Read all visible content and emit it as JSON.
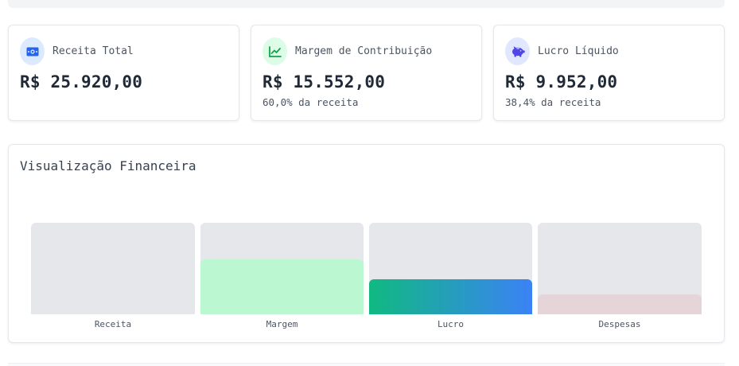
{
  "cards": [
    {
      "icon": "money-bill-icon",
      "icon_color": "#2563eb",
      "icon_bg": "#dbeafe",
      "label": "Receita Total",
      "value": "R$ 25.920,00",
      "sub": ""
    },
    {
      "icon": "chart-line-icon",
      "icon_color": "#16a34a",
      "icon_bg": "#dcfce7",
      "label": "Margem de Contribuição",
      "value": "R$ 15.552,00",
      "sub": "60,0% da receita"
    },
    {
      "icon": "piggy-bank-icon",
      "icon_color": "#4f46e5",
      "icon_bg": "#e0e7ff",
      "label": "Lucro Líquido",
      "value": "R$ 9.952,00",
      "sub": "38,4% da receita"
    }
  ],
  "visualization": {
    "title": "Visualização Financeira",
    "bars": [
      {
        "label": "Receita",
        "fill_fraction": 0.0,
        "fill_color": "#e5e7eb"
      },
      {
        "label": "Margem",
        "fill_fraction": 0.6,
        "fill_color": "#bbf7d0"
      },
      {
        "label": "Lucro",
        "fill_fraction": 0.384,
        "fill_color": "linear-gradient(90deg, #10b981, #3b82f6)"
      },
      {
        "label": "Despesas",
        "fill_fraction": 0.216,
        "fill_color": "#e6d5d8"
      }
    ]
  }
}
